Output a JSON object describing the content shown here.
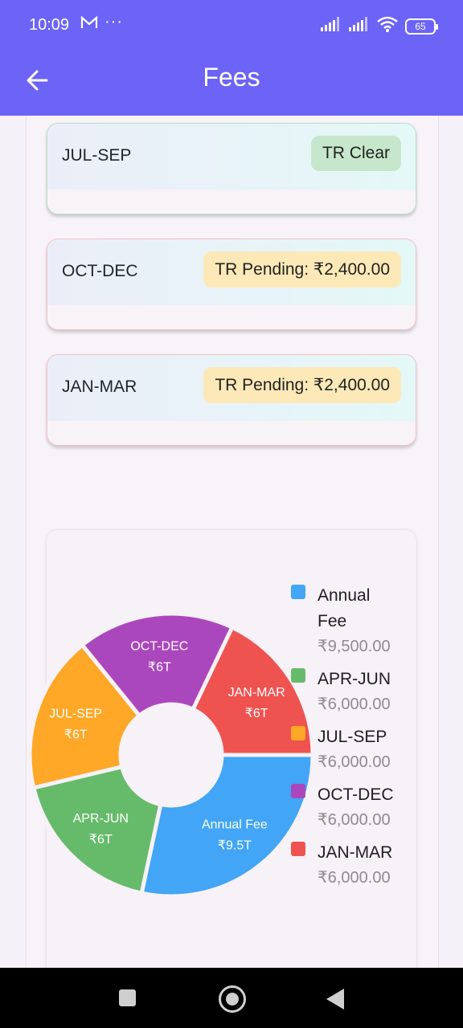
{
  "status_bar": {
    "time": "10:09",
    "battery": "65"
  },
  "app_bar": {
    "title": "Fees"
  },
  "fee_cards": [
    {
      "period": "JUL-SEP",
      "status": "TR Clear",
      "status_type": "clear"
    },
    {
      "period": "OCT-DEC",
      "status": "TR Pending: ₹2,400.00",
      "status_type": "pending"
    },
    {
      "period": "JAN-MAR",
      "status": "TR Pending: ₹2,400.00",
      "status_type": "pending"
    }
  ],
  "chart_data": {
    "type": "pie",
    "categories": [
      "Annual Fee",
      "APR-JUN",
      "JUL-SEP",
      "OCT-DEC",
      "JAN-MAR"
    ],
    "values": [
      9500,
      6000,
      6000,
      6000,
      6000
    ],
    "slice_labels": [
      {
        "name": "Annual Fee",
        "value": "₹9.5T"
      },
      {
        "name": "APR-JUN",
        "value": "₹6T"
      },
      {
        "name": "JUL-SEP",
        "value": "₹6T"
      },
      {
        "name": "OCT-DEC",
        "value": "₹6T"
      },
      {
        "name": "JAN-MAR",
        "value": "₹6T"
      }
    ],
    "colors": [
      "#42a5f5",
      "#66bb6a",
      "#ffa726",
      "#ab47bc",
      "#ef5350"
    ],
    "legend_placement": "right",
    "legend": [
      {
        "name": "Annual Fee",
        "value": "₹9,500.00"
      },
      {
        "name": "APR-JUN",
        "value": "₹6,000.00"
      },
      {
        "name": "JUL-SEP",
        "value": "₹6,000.00"
      },
      {
        "name": "OCT-DEC",
        "value": "₹6,000.00"
      },
      {
        "name": "JAN-MAR",
        "value": "₹6,000.00"
      }
    ]
  },
  "nav_bar": {
    "icons": [
      "recents-icon",
      "home-icon",
      "back-icon"
    ]
  }
}
